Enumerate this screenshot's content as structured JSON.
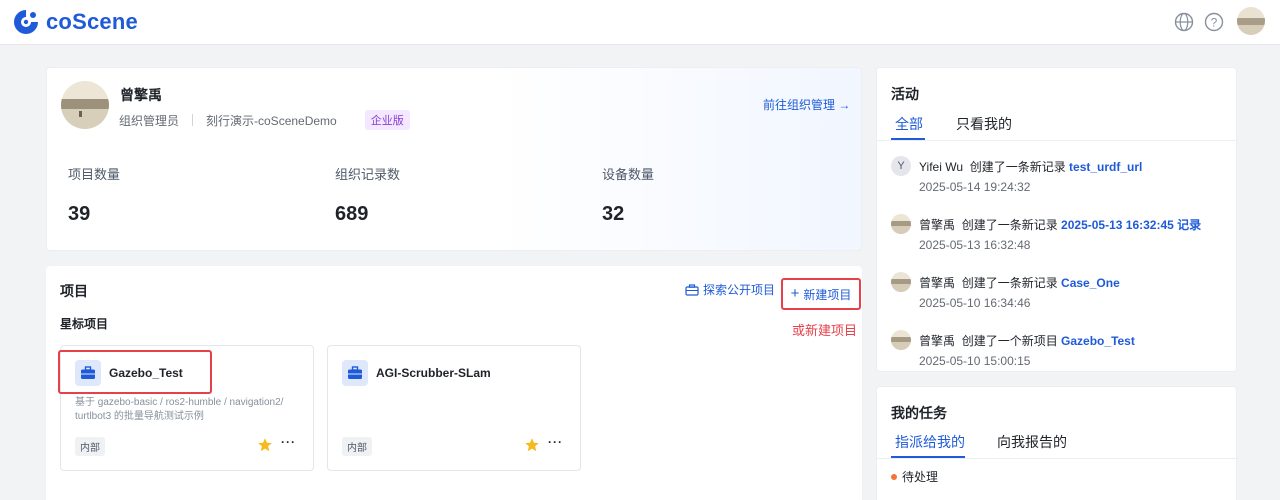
{
  "header": {
    "brand": "coScene",
    "icons": [
      "globe-icon",
      "help-icon",
      "user-avatar"
    ]
  },
  "profile": {
    "name": "曾擎禹",
    "role": "组织管理员",
    "org": "刻行演示-coSceneDemo",
    "plan_badge": "企业版",
    "goto_org": "前往组织管理",
    "stats": [
      {
        "label": "项目数量",
        "value": "39"
      },
      {
        "label": "组织记录数",
        "value": "689"
      },
      {
        "label": "设备数量",
        "value": "32"
      }
    ]
  },
  "projects": {
    "title": "项目",
    "explore": "探索公开项目",
    "new_project": "新建项目",
    "annotation": "或新建项目",
    "starred_title": "星标项目",
    "items": [
      {
        "name": "Gazebo_Test",
        "desc": "基于 gazebo-basic / ros2-humble / navigation2/ turtlbot3 的批量导航测试示例",
        "tag": "内部",
        "starred": true
      },
      {
        "name": "AGI-Scrubber-SLam",
        "desc": "",
        "tag": "内部",
        "starred": true
      }
    ]
  },
  "activity": {
    "title": "活动",
    "tabs": [
      "全部",
      "只看我的"
    ],
    "active_tab": "全部",
    "items": [
      {
        "avatar_letter": "Y",
        "user": "Yifei Wu",
        "action": "创建了一条新记录",
        "target": "test_urdf_url",
        "time": "2025-05-14 19:24:32"
      },
      {
        "avatar_letter": "",
        "user": "曾擎禹",
        "action": "创建了一条新记录",
        "target": "2025-05-13 16:32:45 记录",
        "time": "2025-05-13 16:32:48"
      },
      {
        "avatar_letter": "",
        "user": "曾擎禹",
        "action": "创建了一条新记录",
        "target": "Case_One",
        "time": "2025-05-10 16:34:46"
      },
      {
        "avatar_letter": "",
        "user": "曾擎禹",
        "action": "创建了一个新项目",
        "target": "Gazebo_Test",
        "time": "2025-05-10 15:00:15"
      }
    ]
  },
  "tasks": {
    "title": "我的任务",
    "tabs": [
      "指派给我的",
      "向我报告的"
    ],
    "active_tab": "指派给我的",
    "pending": "待处理"
  },
  "colors": {
    "primary": "#1f5bd8",
    "highlight_red": "#e5414b",
    "enterprise_badge": "#8b3fd1",
    "star": "#f7ba1e",
    "pending_dot": "#f77234"
  }
}
